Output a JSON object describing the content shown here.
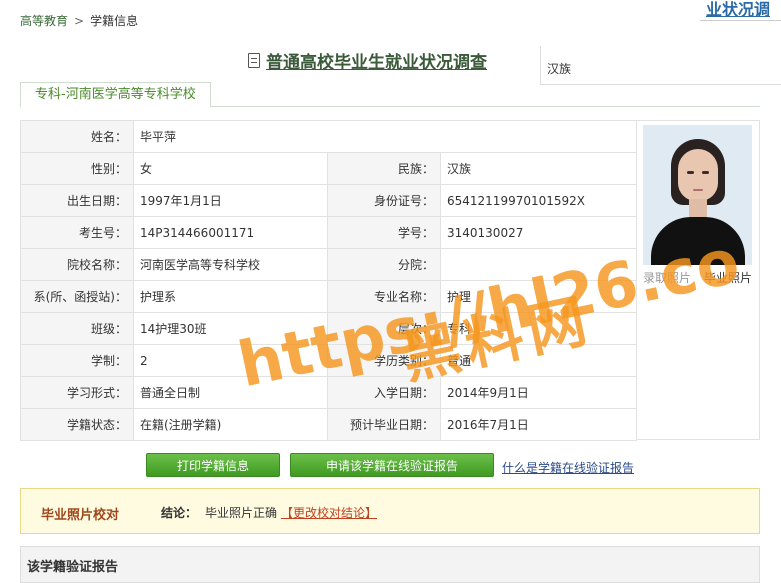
{
  "breadcrumb": {
    "home": "高等教育",
    "separator": ">",
    "current": "学籍信息"
  },
  "corner_title": "业状况调",
  "survey_link": "普通高校毕业生就业状况调查",
  "side_box_text": "汉族",
  "school_tab": "专科-河南医学高等专科学校",
  "info": {
    "name_label": "姓名：",
    "name": "毕平萍",
    "gender_label": "性别：",
    "gender": "女",
    "ethnicity_label": "民族：",
    "ethnicity": "汉族",
    "birth_label": "出生日期：",
    "birth": "1997年1月1日",
    "id_label": "身份证号：",
    "id": "65412119970101592X",
    "exam_label": "考生号：",
    "exam": "14P314466001171",
    "student_label": "学号：",
    "student": "3140130027",
    "college_label": "院校名称：",
    "college": "河南医学高等专科学校",
    "branch_label": "分院：",
    "branch": "",
    "dept_label": "系(所、函授站)：",
    "dept": "护理系",
    "major_label": "专业名称：",
    "major": "护理",
    "class_label": "班级：",
    "class": "14护理30班",
    "level_label": "层次：",
    "level": "专科",
    "duration_label": "学制：",
    "duration": "2",
    "type_label": "学历类别：",
    "type": "普通",
    "form_label": "学习形式：",
    "form": "普通全日制",
    "enroll_label": "入学日期：",
    "enroll": "2014年9月1日",
    "status_label": "学籍状态：",
    "status": "在籍(注册学籍)",
    "grad_label": "预计毕业日期：",
    "grad": "2016年7月1日"
  },
  "photo": {
    "admission_label": "录取照片",
    "graduation_label": "毕业照片"
  },
  "buttons": {
    "print": "打印学籍信息",
    "verify": "申请该学籍在线验证报告",
    "what_is": "什么是学籍在线验证报告"
  },
  "photo_check": {
    "title": "毕业照片校对",
    "conclusion_label": "结论：",
    "conclusion": "毕业照片正确",
    "change_link": "【更改校对结论】"
  },
  "report_title": "该学籍验证报告",
  "watermark": {
    "line1": "黑料网",
    "line2": "https://hl26.co"
  }
}
